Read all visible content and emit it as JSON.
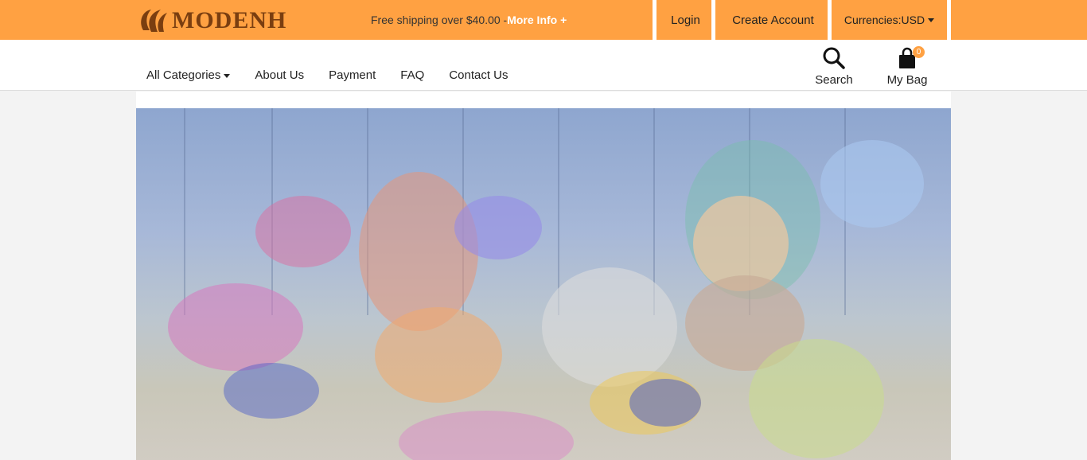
{
  "brand": {
    "name": "MODENH"
  },
  "promo": {
    "text": "Free shipping over $40.00 -",
    "more": "More Info +"
  },
  "account": {
    "login": "Login",
    "create": "Create Account",
    "currency": "Currencies:USD"
  },
  "menu": {
    "items": [
      "All Categories",
      "About Us",
      "Payment",
      "FAQ",
      "Contact Us"
    ]
  },
  "tools": {
    "search": "Search",
    "bag": "My Bag",
    "bag_count": "0"
  },
  "colors": {
    "accent": "#ffa142",
    "logo": "#7a3e10"
  }
}
